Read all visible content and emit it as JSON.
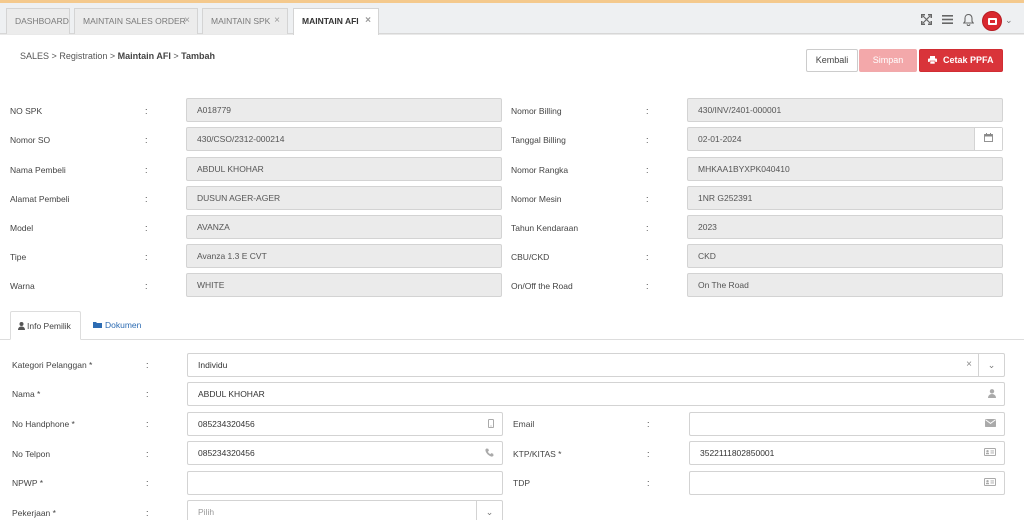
{
  "tabs": [
    {
      "label": "DASHBOARD",
      "closable": false,
      "active": false
    },
    {
      "label": "MAINTAIN SALES ORDER",
      "closable": true,
      "active": false
    },
    {
      "label": "MAINTAIN SPK",
      "closable": true,
      "active": false
    },
    {
      "label": "MAINTAIN AFI",
      "closable": true,
      "active": true
    }
  ],
  "tab_close_glyph": "×",
  "topbar_icons": [
    "expand-icon",
    "menu-icon",
    "bell-icon",
    "user-avatar-icon",
    "chevron-down-icon"
  ],
  "breadcrumb": {
    "items": [
      "SALES",
      "Registration",
      "Maintain AFI",
      "Tambah"
    ],
    "separator": ">"
  },
  "buttons": {
    "back": "Kembali",
    "save": "Simpan",
    "print": "Cetak PPFA"
  },
  "colors": {
    "accent": "#d9343a",
    "accent_disabled": "#f3a8aa",
    "link": "#2d6cb3",
    "readonly_bg": "#ebebeb"
  },
  "colon": ":",
  "spk_left": [
    {
      "label": "NO SPK",
      "value": "A018779"
    },
    {
      "label": "Nomor SO",
      "value": "430/CSO/2312-000214"
    },
    {
      "label": "Nama Pembeli",
      "value": "ABDUL KHOHAR"
    },
    {
      "label": "Alamat Pembeli",
      "value": "DUSUN AGER-AGER"
    },
    {
      "label": "Model",
      "value": "AVANZA"
    },
    {
      "label": "Tipe",
      "value": "Avanza 1.3 E CVT"
    },
    {
      "label": "Warna",
      "value": "WHITE"
    }
  ],
  "spk_right": [
    {
      "label": "Nomor Billing",
      "value": "430/INV/2401-000001"
    },
    {
      "label": "Tanggal Billing",
      "value": "02-01-2024"
    },
    {
      "label": "Nomor Rangka",
      "value": "MHKAA1BYXPK040410"
    },
    {
      "label": "Nomor Mesin",
      "value": "1NR G252391"
    },
    {
      "label": "Tahun Kendaraan",
      "value": "2023"
    },
    {
      "label": "CBU/CKD",
      "value": "CKD"
    },
    {
      "label": "On/Off the Road",
      "value": "On The Road"
    }
  ],
  "subtabs": {
    "info": "Info Pemilik",
    "docs": "Dokumen"
  },
  "owner": {
    "kategori": {
      "label": "Kategori Pelanggan *",
      "value": "Individu"
    },
    "nama": {
      "label": "Nama *",
      "value": "ABDUL KHOHAR"
    },
    "handphone": {
      "label": "No Handphone *",
      "value": "085234320456"
    },
    "telpon": {
      "label": "No Telpon",
      "value": "085234320456"
    },
    "npwp": {
      "label": "NPWP *",
      "value": ""
    },
    "pekerjaan": {
      "label": "Pekerjaan *",
      "placeholder": "Pilih"
    },
    "email": {
      "label": "Email",
      "value": ""
    },
    "ktp": {
      "label": "KTP/KITAS *",
      "value": "3522111802850001"
    },
    "tdp": {
      "label": "TDP",
      "value": ""
    }
  }
}
